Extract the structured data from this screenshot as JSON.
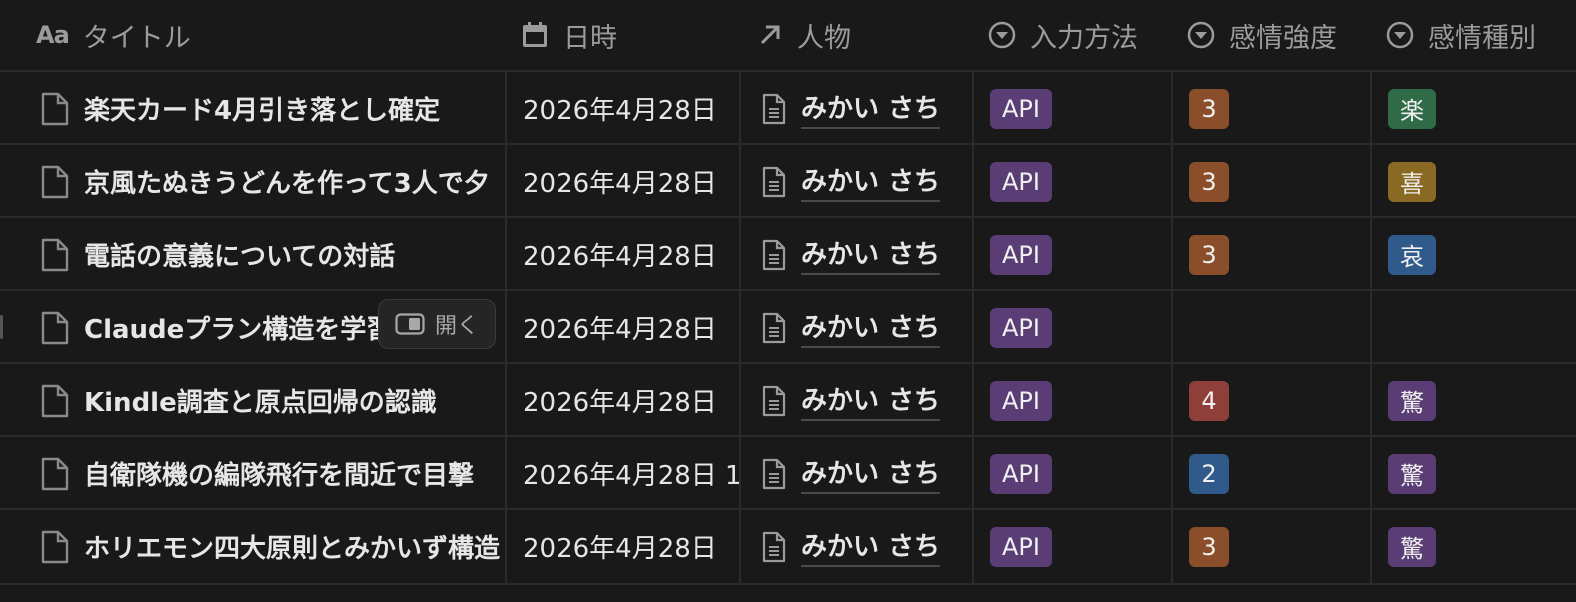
{
  "headers": {
    "title": "タイトル",
    "date": "日時",
    "person": "人物",
    "method": "入力方法",
    "intensity": "感情強度",
    "kind": "感情種別",
    "title_icon": "Aa"
  },
  "open_button_label": "開く",
  "rows": [
    {
      "title": "楽天カード4月引き落とし確定",
      "date": "2026年4月28日",
      "person": "みかい さち",
      "method": "API",
      "intensity": "3",
      "intensity_color": "#8a4e2b",
      "kind": "楽",
      "kind_color": "#2f6b47"
    },
    {
      "title": "京風たぬきうどんを作って3人で夕",
      "date": "2026年4月28日",
      "person": "みかい さち",
      "method": "API",
      "intensity": "3",
      "intensity_color": "#8a4e2b",
      "kind": "喜",
      "kind_color": "#8a6a22"
    },
    {
      "title": "電話の意義についての対話",
      "date": "2026年4月28日",
      "person": "みかい さち",
      "method": "API",
      "intensity": "3",
      "intensity_color": "#8a4e2b",
      "kind": "哀",
      "kind_color": "#2f5a8a"
    },
    {
      "title": "Claudeプラン構造を学習",
      "date": "2026年4月28日",
      "person": "みかい さち",
      "method": "API",
      "intensity": "",
      "intensity_color": "",
      "kind": "",
      "kind_color": ""
    },
    {
      "title": "Kindle調査と原点回帰の認識",
      "date": "2026年4月28日",
      "person": "みかい さち",
      "method": "API",
      "intensity": "4",
      "intensity_color": "#8f3f3a",
      "kind": "驚",
      "kind_color": "#5a3d75"
    },
    {
      "title": "自衛隊機の編隊飛行を間近で目撃",
      "date": "2026年4月28日 1",
      "person": "みかい さち",
      "method": "API",
      "intensity": "2",
      "intensity_color": "#2f5a8a",
      "kind": "驚",
      "kind_color": "#5a3d75"
    },
    {
      "title": "ホリエモン四大原則とみかいず構造",
      "date": "2026年4月28日",
      "person": "みかい さち",
      "method": "API",
      "intensity": "3",
      "intensity_color": "#8a4e2b",
      "kind": "驚",
      "kind_color": "#5a3d75"
    }
  ]
}
